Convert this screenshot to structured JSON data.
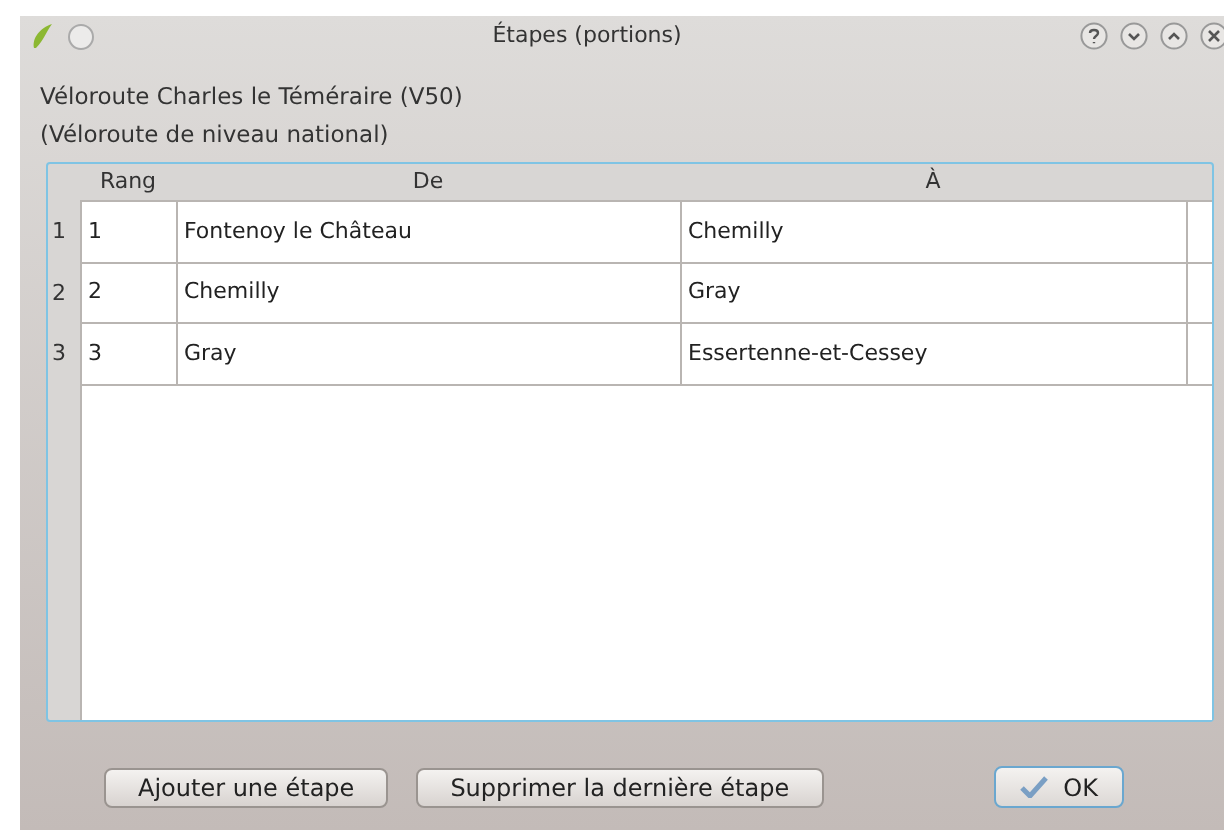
{
  "window": {
    "title": "Étapes (portions)"
  },
  "heading": "Véloroute Charles le Téméraire (V50)",
  "subheading": "(Véloroute de niveau national)",
  "table": {
    "columns": [
      "Rang",
      "De",
      "À"
    ],
    "rows": [
      {
        "header": "1",
        "cells": [
          "1",
          "Fontenoy le Château",
          "Chemilly"
        ]
      },
      {
        "header": "2",
        "cells": [
          "2",
          "Chemilly",
          "Gray"
        ]
      },
      {
        "header": "3",
        "cells": [
          "3",
          "Gray",
          "Essertenne-et-Cessey"
        ]
      }
    ]
  },
  "buttons": [
    {
      "label": "Ajouter une étape",
      "kind": "plain"
    },
    {
      "label": "Supprimer la dernière étape",
      "kind": "plain"
    },
    {
      "label": "OK",
      "kind": "default"
    }
  ]
}
